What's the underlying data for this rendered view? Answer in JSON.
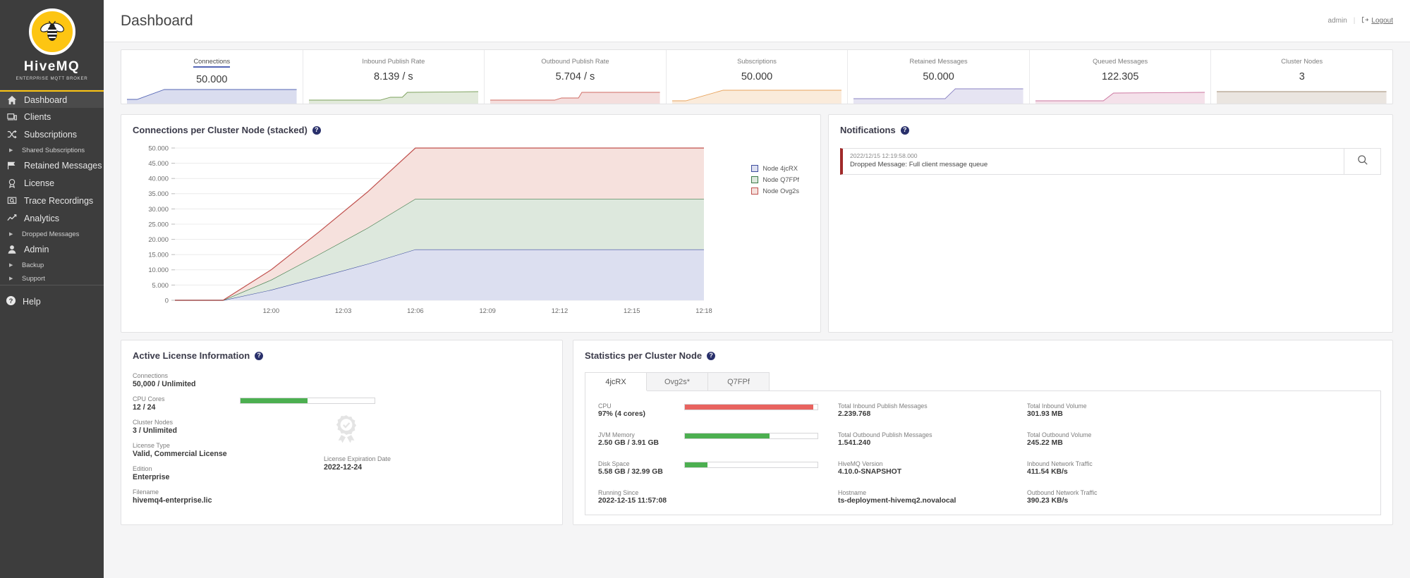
{
  "brand": {
    "name": "HiveMQ",
    "tagline": "ENTERPRISE MQTT BROKER",
    "bee_icon": "bee-icon",
    "accent": "#fdc512"
  },
  "sidebar": {
    "items": [
      {
        "label": "Dashboard",
        "icon": "home-icon",
        "active": true
      },
      {
        "label": "Clients",
        "icon": "monitor-icon",
        "active": false
      },
      {
        "label": "Subscriptions",
        "icon": "shuffle-icon",
        "active": false
      },
      {
        "label": "Retained Messages",
        "icon": "flag-icon",
        "active": false
      },
      {
        "label": "License",
        "icon": "award-icon",
        "active": false
      },
      {
        "label": "Trace Recordings",
        "icon": "trace-icon",
        "active": false
      },
      {
        "label": "Analytics",
        "icon": "chart-line-icon",
        "active": false
      },
      {
        "label": "Admin",
        "icon": "user-icon",
        "active": false
      }
    ],
    "sub_shared_subscriptions": "Shared Subscriptions",
    "sub_dropped_messages": "Dropped Messages",
    "sub_backup": "Backup",
    "sub_support": "Support",
    "help": "Help"
  },
  "header": {
    "title": "Dashboard",
    "user": "admin",
    "separator": "|",
    "logout": "Logout"
  },
  "metrics": [
    {
      "label": "Connections",
      "value": "50.000",
      "selected": true,
      "color": "#5566b5"
    },
    {
      "label": "Inbound Publish Rate",
      "value": "8.139 / s",
      "selected": false,
      "color": "#7ba05b"
    },
    {
      "label": "Outbound Publish Rate",
      "value": "5.704 / s",
      "selected": false,
      "color": "#cf6b63"
    },
    {
      "label": "Subscriptions",
      "value": "50.000",
      "selected": false,
      "color": "#e8a35c"
    },
    {
      "label": "Retained Messages",
      "value": "50.000",
      "selected": false,
      "color": "#8b83c4"
    },
    {
      "label": "Queued Messages",
      "value": "122.305",
      "selected": false,
      "color": "#cc76a0"
    },
    {
      "label": "Cluster Nodes",
      "value": "3",
      "selected": false,
      "color": "#a08a72"
    }
  ],
  "chart_panel": {
    "title": "Connections per Cluster Node (stacked)",
    "help_icon": "help-circle-icon"
  },
  "chart_data": {
    "type": "area",
    "stacked": true,
    "title": "Connections per Cluster Node (stacked)",
    "xlabel": "",
    "ylabel": "",
    "grid": true,
    "legend_position": "right",
    "ylim": [
      0,
      50000
    ],
    "ytick_labels": [
      "50.000",
      "45.000",
      "40.000",
      "35.000",
      "30.000",
      "25.000",
      "20.000",
      "15.000",
      "10.000",
      "5.000",
      "0"
    ],
    "ytick_values": [
      50000,
      45000,
      40000,
      35000,
      30000,
      25000,
      20000,
      15000,
      10000,
      5000,
      0
    ],
    "xtick_labels": [
      "12:00",
      "12:03",
      "12:06",
      "12:09",
      "12:12",
      "12:15",
      "12:18"
    ],
    "x": [
      "11:58",
      "11:59",
      "12:00",
      "12:01",
      "12:02",
      "12:03",
      "12:06",
      "12:09",
      "12:12",
      "12:15",
      "12:18",
      "12:20"
    ],
    "series": [
      {
        "name": "Node 4jcRX",
        "color": "#3d4d9e",
        "fill": "#dcdff0",
        "values": [
          0,
          0,
          3400,
          7600,
          11900,
          16700,
          16700,
          16700,
          16700,
          16700,
          16700,
          16700
        ]
      },
      {
        "name": "Node Q7FPf",
        "color": "#3d7a48",
        "fill": "#dde8dd",
        "values": [
          0,
          0,
          3300,
          7500,
          11800,
          16600,
          16600,
          16600,
          16600,
          16600,
          16600,
          16600
        ]
      },
      {
        "name": "Node Ovg2s",
        "color": "#c0504d",
        "fill": "#f6e1dd",
        "values": [
          0,
          0,
          3300,
          7400,
          11800,
          16700,
          16700,
          16700,
          16700,
          16700,
          16700,
          16700
        ]
      }
    ]
  },
  "notifications": {
    "title": "Notifications",
    "help_icon": "help-circle-icon",
    "items": [
      {
        "timestamp": "2022/12/15 12:19:58.000",
        "message": "Dropped Message: Full client message queue",
        "severity_color": "#a02a2a",
        "action_icon": "search-icon"
      }
    ]
  },
  "license": {
    "title": "Active License Information",
    "help_icon": "help-circle-icon",
    "rows": [
      {
        "key": "Connections",
        "value": "50,000 / Unlimited",
        "bar": null
      },
      {
        "key": "CPU Cores",
        "value": "12 / 24",
        "bar": 50
      },
      {
        "key": "Cluster Nodes",
        "value": "3 / Unlimited",
        "bar": null
      },
      {
        "key": "License Type",
        "value": "Valid, Commercial License",
        "bar": null
      },
      {
        "key": "Edition",
        "value": "Enterprise",
        "bar": null
      },
      {
        "key": "Filename",
        "value": "hivemq4-enterprise.lic",
        "bar": null
      }
    ],
    "expiration_key": "License Expiration Date",
    "expiration_value": "2022-12-24",
    "medal_icon": "award-ribbon-icon"
  },
  "stats": {
    "title": "Statistics per Cluster Node",
    "help_icon": "help-circle-icon",
    "tabs": [
      {
        "label": "4jcRX",
        "active": true
      },
      {
        "label": "Ovg2s*",
        "active": false
      },
      {
        "label": "Q7FPf",
        "active": false
      }
    ],
    "col1": [
      {
        "key": "CPU",
        "value": "97% (4 cores)",
        "bar": 97,
        "bar_color": "#e8635f"
      },
      {
        "key": "JVM Memory",
        "value": "2.50 GB / 3.91 GB",
        "bar": 64,
        "bar_color": "#4caf50"
      },
      {
        "key": "Disk Space",
        "value": "5.58 GB / 32.99 GB",
        "bar": 17,
        "bar_color": "#4caf50"
      },
      {
        "key": "Running Since",
        "value": "2022-12-15 11:57:08",
        "bar": null,
        "bar_color": null
      }
    ],
    "col2": [
      {
        "key": "Total Inbound Publish Messages",
        "value": "2.239.768"
      },
      {
        "key": "Total Outbound Publish Messages",
        "value": "1.541.240"
      },
      {
        "key": "HiveMQ Version",
        "value": "4.10.0-SNAPSHOT"
      },
      {
        "key": "Hostname",
        "value": "ts-deployment-hivemq2.novalocal"
      }
    ],
    "col3": [
      {
        "key": "Total Inbound Volume",
        "value": "301.93 MB"
      },
      {
        "key": "Total Outbound Volume",
        "value": "245.22 MB"
      },
      {
        "key": "Inbound Network Traffic",
        "value": "411.54 KB/s"
      },
      {
        "key": "Outbound Network Traffic",
        "value": "390.23 KB/s"
      }
    ]
  }
}
